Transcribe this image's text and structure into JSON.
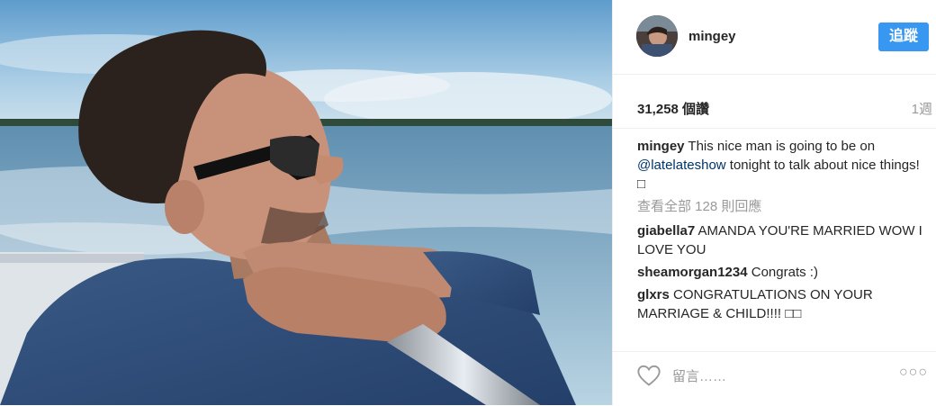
{
  "post": {
    "username": "mingey",
    "follow_label": "追蹤",
    "likes": "31,258 個讚",
    "time": "1週",
    "caption_user": "mingey",
    "caption_text_1": "This nice man is going to be on",
    "caption_mention": "@latelateshow",
    "caption_text_2": "tonight to talk about nice things! □",
    "view_all": "查看全部 128 則回應",
    "comments": [
      {
        "user": "giabella7",
        "text": "AMANDA YOU'RE MARRIED WOW I LOVE YOU"
      },
      {
        "user": "sheamorgan1234",
        "text": "Congrats :)"
      },
      {
        "user": "glxrs",
        "text": "CONGRATULATIONS ON YOUR MARRIAGE & CHILD!!!! □□"
      }
    ],
    "add_comment_placeholder": "留言……",
    "more_label": "○○○"
  },
  "icons": {
    "like": "heart-icon",
    "more": "more-options-icon"
  },
  "colors": {
    "accent": "#3897f0",
    "text": "#262626",
    "muted": "#999999",
    "link": "#003569"
  }
}
